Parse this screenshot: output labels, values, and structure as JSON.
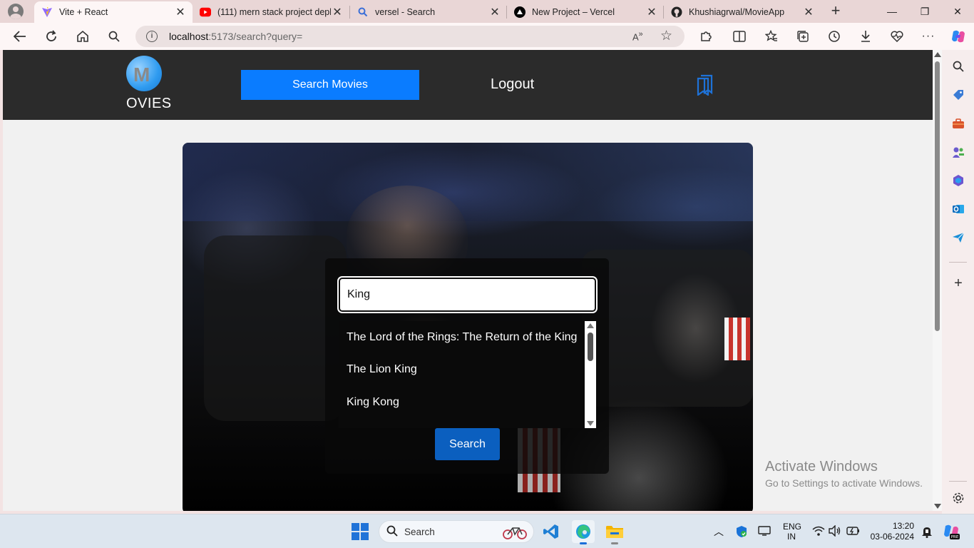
{
  "browser": {
    "tabs": [
      {
        "title": "Vite + React",
        "active": true,
        "icon": "vite-icon"
      },
      {
        "title": "(111) mern stack project depl",
        "active": false,
        "icon": "youtube-icon"
      },
      {
        "title": "versel - Search",
        "active": false,
        "icon": "bing-search-icon"
      },
      {
        "title": "New Project – Vercel",
        "active": false,
        "icon": "vercel-icon"
      },
      {
        "title": "Khushiagrwal/MovieApp",
        "active": false,
        "icon": "github-icon"
      }
    ],
    "tab_close": "✕",
    "new_tab": "+",
    "address": {
      "host": "localhost",
      "rest": ":5173/search?query="
    },
    "window_controls": {
      "minimize": "—",
      "restore": "❐",
      "close": "✕"
    }
  },
  "app": {
    "logo_text": "OVIES",
    "logo_letter": "M",
    "nav_search_label": "Search Movies",
    "nav_logout_label": "Logout",
    "search": {
      "query": "King",
      "results": [
        "The Lord of the Rings: The Return of the King",
        "The Lion King",
        "King Kong"
      ],
      "button_label": "Search"
    }
  },
  "watermark": {
    "title": "Activate Windows",
    "subtitle": "Go to Settings to activate Windows."
  },
  "taskbar": {
    "search_label": "Search",
    "language": "ENG",
    "region": "IN",
    "time": "13:20",
    "date": "03-06-2024"
  },
  "colors": {
    "app_nav_bg": "#2b2b2b",
    "nav_search_button": "#0a7cff",
    "search_button": "#0b5fbf",
    "browser_frame": "#e9d6d6"
  }
}
